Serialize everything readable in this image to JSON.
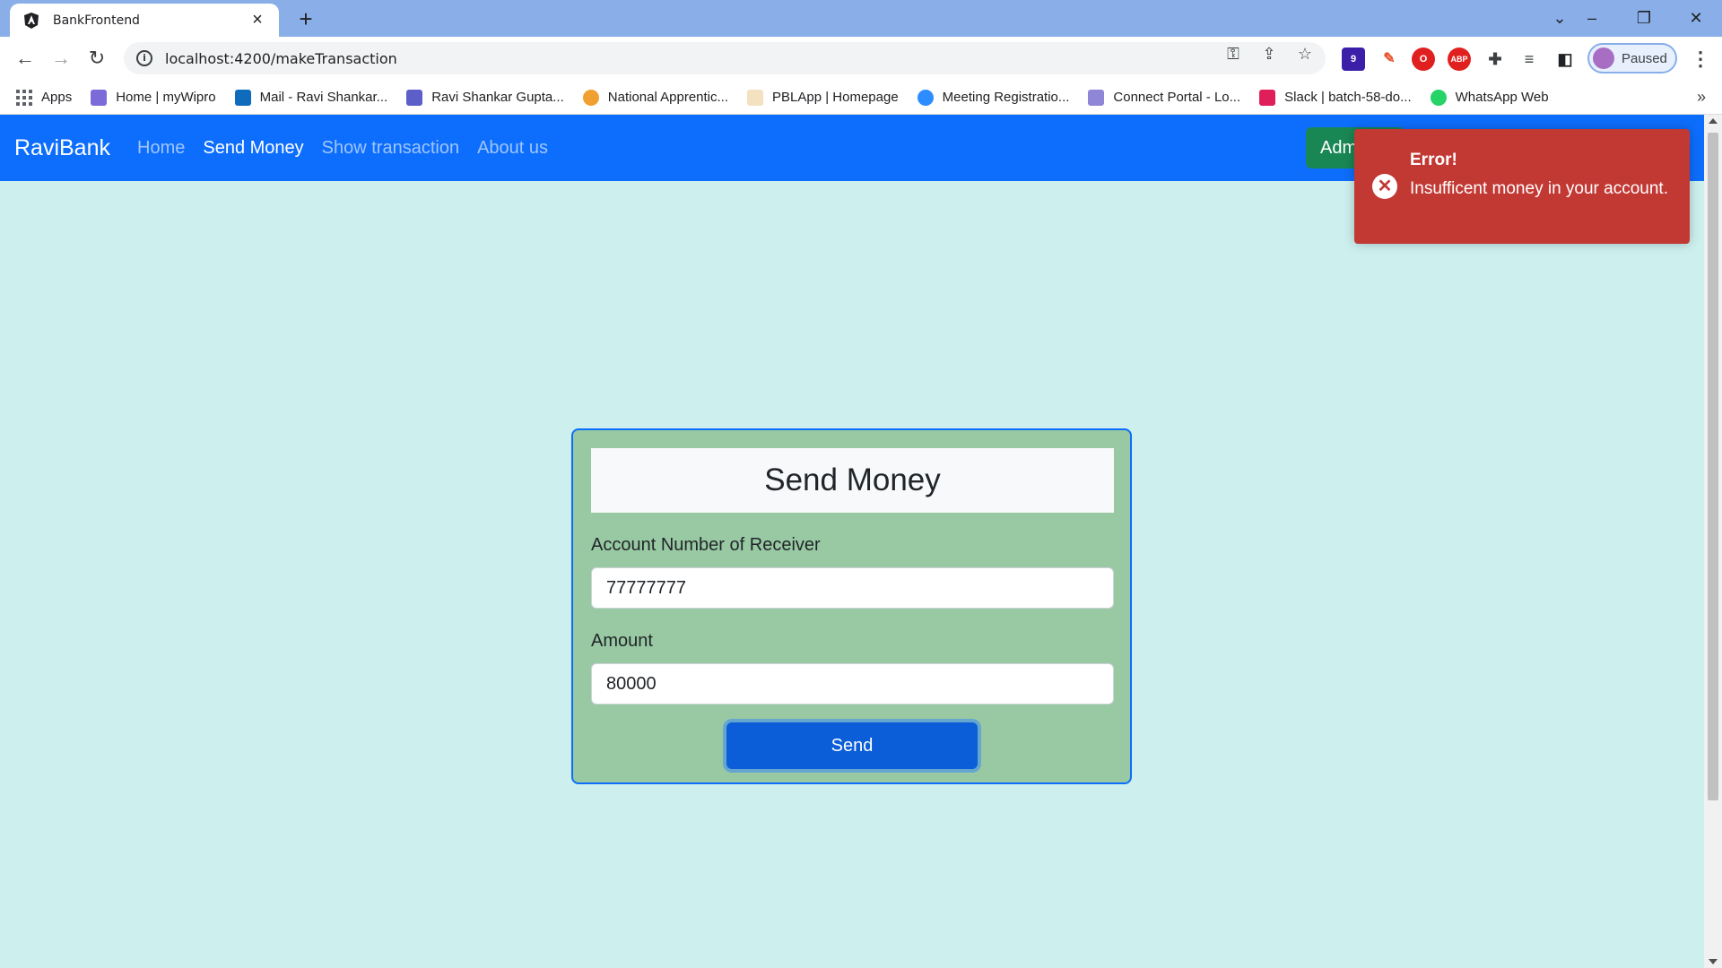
{
  "browser": {
    "tab_title": "BankFrontend",
    "url": "localhost:4200/makeTransaction",
    "profile_label": "Paused",
    "bookmarks": [
      {
        "label": "Apps"
      },
      {
        "label": "Home | myWipro"
      },
      {
        "label": "Mail - Ravi Shankar..."
      },
      {
        "label": "Ravi Shankar Gupta..."
      },
      {
        "label": "National Apprentic..."
      },
      {
        "label": "PBLApp | Homepage"
      },
      {
        "label": "Meeting Registratio..."
      },
      {
        "label": "Connect Portal - Lo..."
      },
      {
        "label": "Slack | batch-58-do..."
      },
      {
        "label": "WhatsApp Web"
      }
    ],
    "extension_badge": "9"
  },
  "navbar": {
    "brand": "RaviBank",
    "links": [
      {
        "label": "Home",
        "active": false
      },
      {
        "label": "Send Money",
        "active": true
      },
      {
        "label": "Show transaction",
        "active": false
      },
      {
        "label": "About us",
        "active": false
      }
    ],
    "admin_button": "Admin"
  },
  "form": {
    "title": "Send Money",
    "account_label": "Account Number of Receiver",
    "account_value": "77777777",
    "amount_label": "Amount",
    "amount_value": "80000",
    "submit_label": "Send"
  },
  "toast": {
    "title": "Error!",
    "message": "Insufficent money in your account."
  },
  "colors": {
    "navbar": "#0d6efd",
    "page_background": "#cdf0ef",
    "card_background": "#98c9a3",
    "toast_background": "#c23934",
    "admin_button": "#198754"
  }
}
